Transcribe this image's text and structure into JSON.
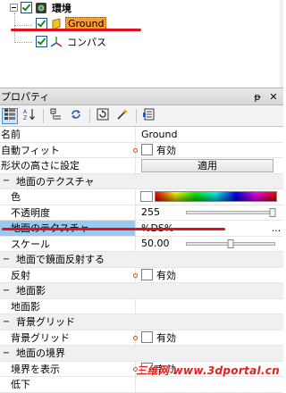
{
  "tree": {
    "environment_label": "環境",
    "ground_label": "Ground",
    "compass_label": "コンパス"
  },
  "panel": {
    "title": "プロパティ",
    "pin_glyph": "ᵽ",
    "close_glyph": "✕"
  },
  "toolbar": {
    "categorized_icon": "categorized-icon",
    "alphabetical_icon": "alphabetical-icon"
  },
  "properties": {
    "name_label": "名前",
    "name_value": "Ground",
    "autofit_label": "自動フィット",
    "autofit_value": "有効",
    "shape_height_label": "形状の高さに設定",
    "apply_button": "適用",
    "texture_section": "地面のテクスチャ",
    "color_label": "色",
    "opacity_label": "不透明度",
    "opacity_value": "255",
    "texture_label": "地面のテクスチャ",
    "texture_value": "%DS%",
    "texture_ellipsis": "...",
    "scale_label": "スケール",
    "scale_value": "50.00",
    "reflection_section": "地面で鏡面反射する",
    "reflection_label": "反射",
    "reflection_value": "有効",
    "shadow_section": "地面影",
    "shadow_label": "地面影",
    "grid_section": "背景グリッド",
    "grid_label": "背景グリッド",
    "grid_value": "有効",
    "boundary_section": "地面の境界",
    "boundary_label": "境界を表示",
    "boundary_value": "有効",
    "low_label": "低下"
  },
  "opacity_level": 0.98,
  "scale_level": 0.5,
  "watermark": "三维网 www.3dportal.cn",
  "colors": {
    "selected_bg": "#ff9c2a",
    "highlight_bg": "#99c9ef",
    "annotation": "#e01020"
  }
}
